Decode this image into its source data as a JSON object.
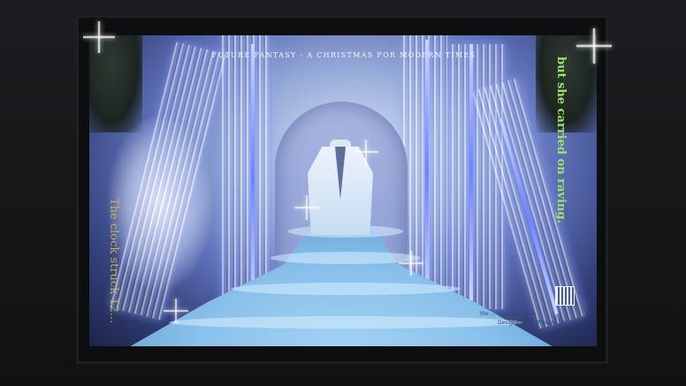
{
  "window_display": {
    "headline": "FUTURE FANTASY - A CHRISTMAS FOR MODERN TIMES",
    "text_right": "but she carried on raving.",
    "text_left": "The clock struck 12...",
    "credit_line_1": "the ... cloak, Balmain",
    "credit_line_2": "Designer ... Selfridges 1Z"
  },
  "colors": {
    "text_green": "#9ce56a",
    "headline_white": "#f4f7ff",
    "gown_blue": "#89c0ea",
    "light_violet": "#6e82ff"
  }
}
